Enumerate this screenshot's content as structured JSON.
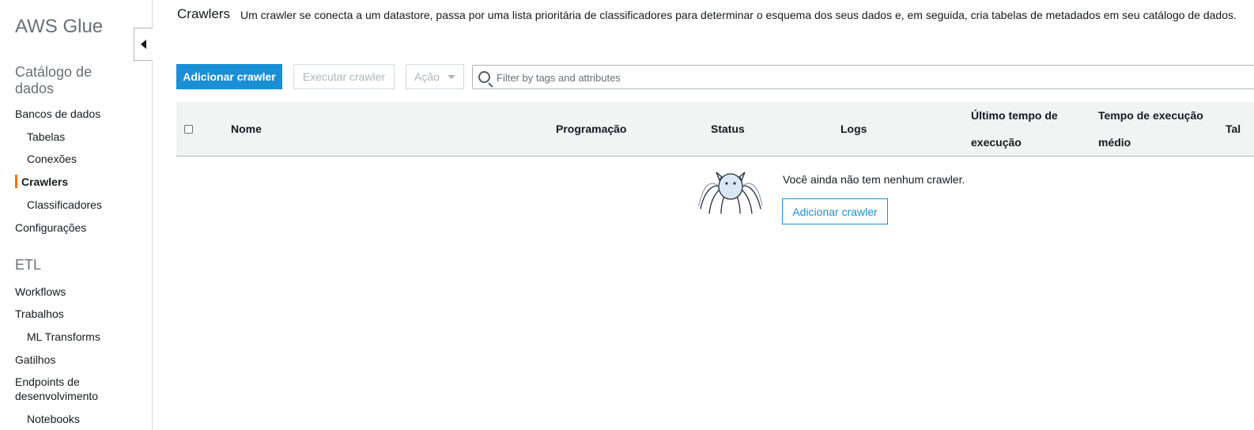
{
  "sidebar": {
    "app_title": "AWS Glue",
    "catalog_heading": "Catálogo de dados",
    "catalog_items": [
      {
        "label": "Bancos de dados"
      },
      {
        "label": "Tabelas"
      },
      {
        "label": "Conexões"
      },
      {
        "label": "Crawlers",
        "active": true
      },
      {
        "label": "Classificadores"
      },
      {
        "label": "Configurações"
      }
    ],
    "etl_heading": "ETL",
    "etl_items": [
      {
        "label": "Workflows"
      },
      {
        "label": "Trabalhos"
      },
      {
        "label": "ML Transforms"
      },
      {
        "label": "Gatilhos"
      },
      {
        "label": "Endpoints de desenvolvimento"
      },
      {
        "label": "Notebooks"
      }
    ]
  },
  "header": {
    "title": "Crawlers",
    "description": "Um crawler se conecta a um datastore, passa por uma lista prioritária de classificadores para determinar o esquema dos seus dados e, em seguida, cria tabelas de metadados em seu catálogo de dados."
  },
  "toolbar": {
    "add_label": "Adicionar crawler",
    "run_label": "Executar crawler",
    "action_label": "Ação",
    "search_placeholder": "Filter by tags and attributes"
  },
  "table": {
    "columns": {
      "name": "Nome",
      "schedule": "Programação",
      "status": "Status",
      "logs": "Logs",
      "last_run_1": "Último tempo de",
      "last_run_2": "execução",
      "avg_run_1": "Tempo de execução",
      "avg_run_2": "médio",
      "tables": "Tal"
    },
    "empty_message": "Você ainda não tem nenhum crawler.",
    "empty_button": "Adicionar crawler"
  },
  "colors": {
    "primary": "#1a8fd6",
    "active_indicator": "#ec7211",
    "header_bg": "#f2f3f3"
  }
}
